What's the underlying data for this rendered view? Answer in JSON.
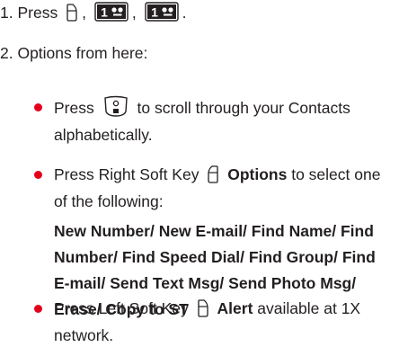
{
  "step1": {
    "prefix": "1. Press",
    "sep1": ",",
    "sep2": ",",
    "end": ".",
    "key_label": "1"
  },
  "step2": {
    "text": "2. Options from here:"
  },
  "bullets": [
    {
      "pre": "Press",
      "post": "to scroll through your Contacts alphabetically."
    },
    {
      "pre": "Press Right Soft Key",
      "bold": "Options",
      "post": "to select one of the following:"
    },
    {
      "pre": "Press Left Soft Key",
      "bold": "Alert",
      "post": "available at 1X network."
    }
  ],
  "options_text": "New Number/ New E-mail/ Find Name/ Find Number/ Find Speed Dial/ Find Group/ Find E-mail/ Send Text Msg/ Send Photo Msg/ Erase/ Copy to ST",
  "colors": {
    "bullet": "#e4001b",
    "text": "#231f20"
  },
  "icons": [
    "left-soft-key-icon",
    "one-voicemail-key-icon",
    "nav-key-icon",
    "right-soft-key-icon"
  ]
}
